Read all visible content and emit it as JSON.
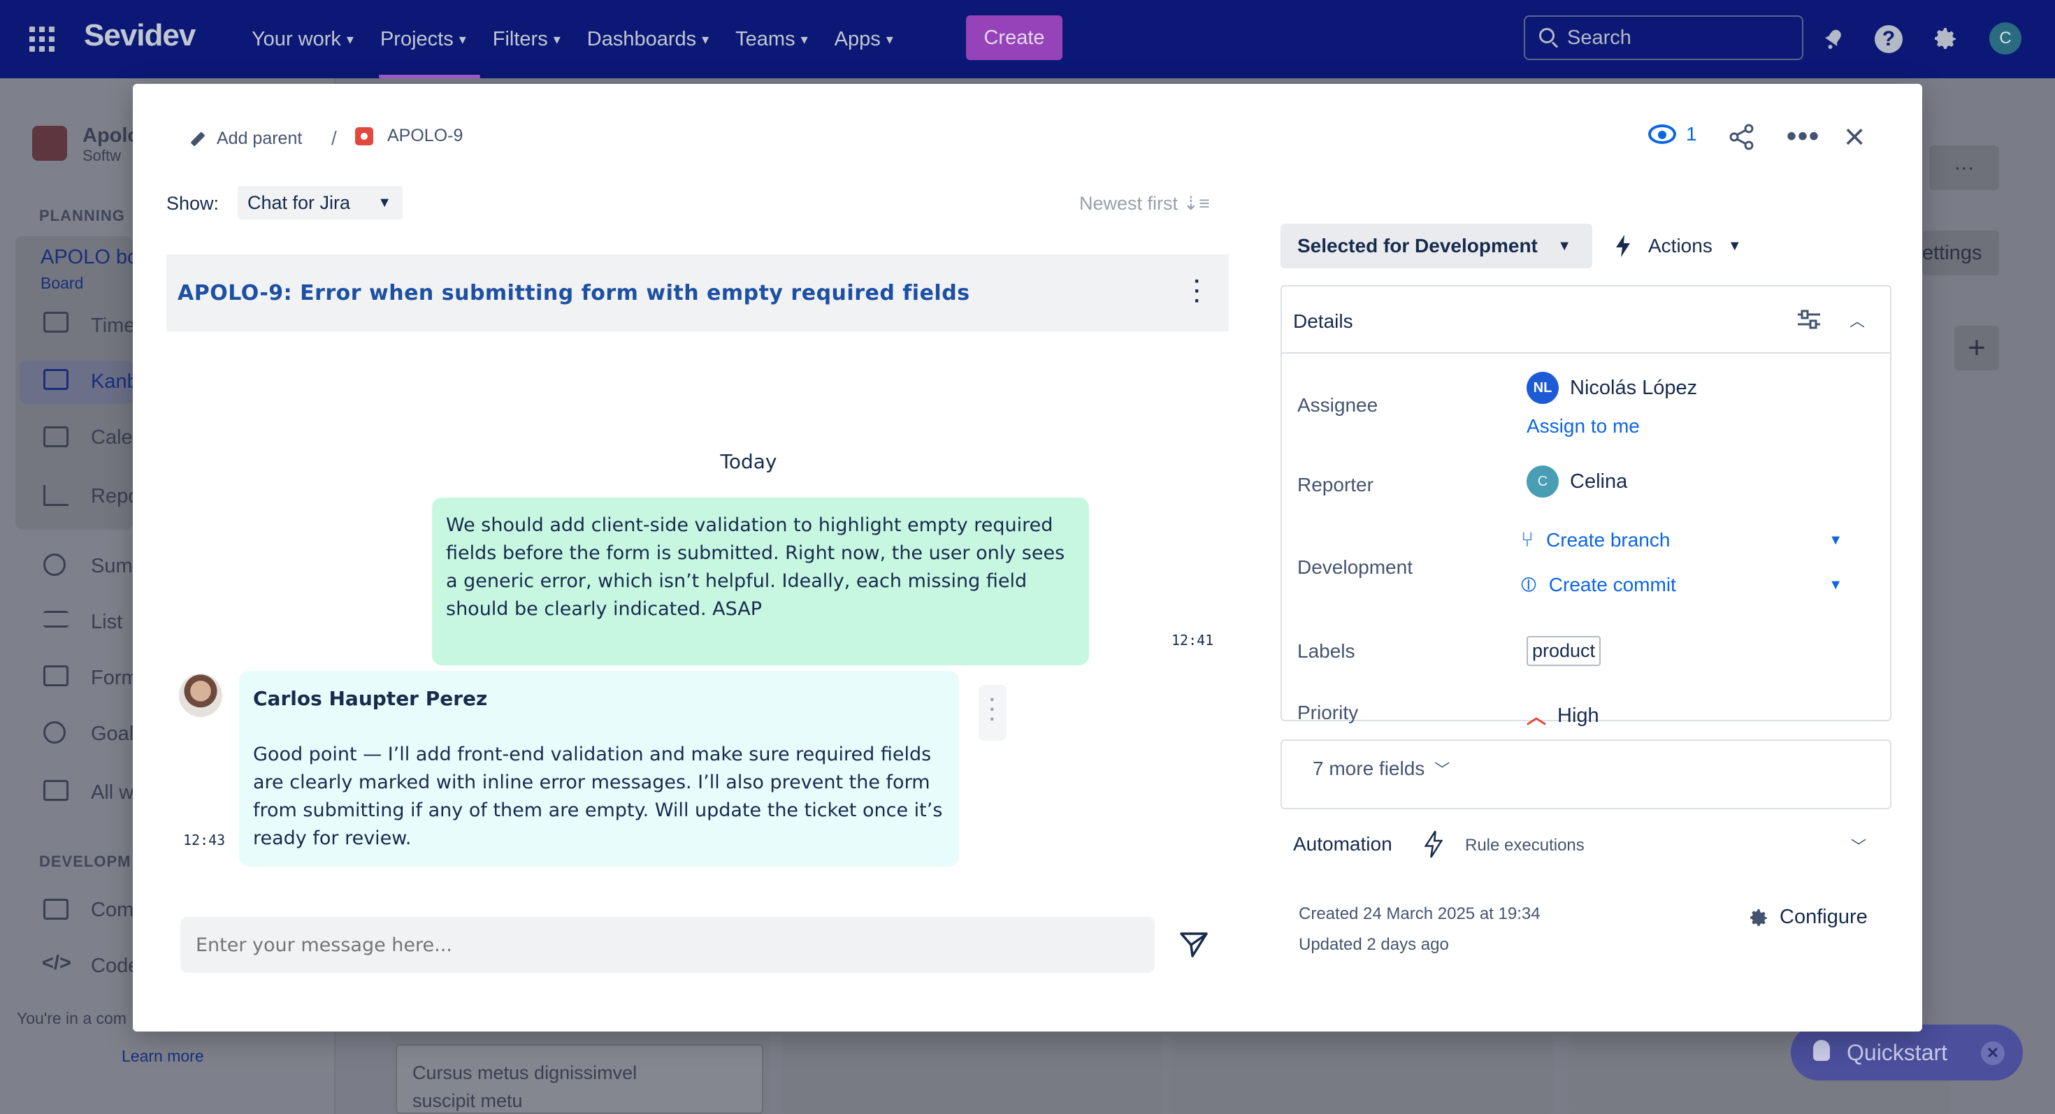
{
  "topnav": {
    "logo": "Sevidev",
    "menu": [
      {
        "label": "Your work"
      },
      {
        "label": "Projects"
      },
      {
        "label": "Filters"
      },
      {
        "label": "Dashboards"
      },
      {
        "label": "Teams"
      },
      {
        "label": "Apps"
      }
    ],
    "active_item": "Projects",
    "create_label": "Create",
    "search_placeholder": "Search",
    "avatar_initial": "C",
    "colors": {
      "bar": "#0b1875",
      "create": "#9642b8"
    }
  },
  "background": {
    "project_name": "Apolo",
    "project_type": "Softw",
    "planning_heading": "PLANNING",
    "board_name": "APOLO bo",
    "board_sub": "Board",
    "nav": [
      "Time",
      "Kanb",
      "Cale",
      "Repo",
      "Sum",
      "List",
      "Form",
      "Goal",
      "All w"
    ],
    "development_heading": "DEVELOPM",
    "dev_nav": [
      "Comp",
      "Code"
    ],
    "footer_text": "You're in a com",
    "learn_more": "Learn more",
    "settings_partial": "ettings",
    "card_text_1": "Cursus metus dignissimvel",
    "card_text_2": "suscipit metu"
  },
  "quickstart": {
    "label": "Quickstart"
  },
  "modal": {
    "breadcrumb": {
      "add_parent": "Add parent",
      "separator": "/",
      "issue_key": "APOLO-9"
    },
    "watchers": "1",
    "chat": {
      "show_label": "Show:",
      "show_value": "Chat for Jira",
      "sort_label": "Newest first",
      "title": "APOLO-9: Error when submitting form with empty required fields",
      "date_divider": "Today",
      "messages": [
        {
          "text": "We should add client-side validation to highlight empty required fields before the form is submitted. Right now, the user only sees a generic error, which isn’t helpful. Ideally, each missing field should be clearly indicated. ASAP",
          "time": "12:41"
        },
        {
          "author": "Carlos Haupter Perez",
          "text": "Good point — I’ll add front-end validation and make sure required fields are clearly marked with inline error messages. I’ll also prevent the form from submitting if any of them are empty. Will update the ticket once it’s ready for review.",
          "time": "12:43"
        }
      ],
      "input_placeholder": "Enter your message here..."
    },
    "status": "Selected for Development",
    "actions_label": "Actions",
    "details": {
      "title": "Details",
      "assignee_label": "Assignee",
      "assignee_initials": "NL",
      "assignee_name": "Nicolás López",
      "assign_to_me": "Assign to me",
      "reporter_label": "Reporter",
      "reporter_initial": "C",
      "reporter_name": "Celina",
      "development_label": "Development",
      "create_branch": "Create branch",
      "create_commit": "Create commit",
      "labels_label": "Labels",
      "label_value": "product",
      "priority_label": "Priority",
      "priority_value": "High",
      "more_fields": "7 more fields"
    },
    "automation": {
      "title": "Automation",
      "rule_executions": "Rule executions"
    },
    "meta": {
      "created": "Created 24 March 2025 at 19:34",
      "updated": "Updated 2 days ago",
      "configure": "Configure"
    }
  }
}
